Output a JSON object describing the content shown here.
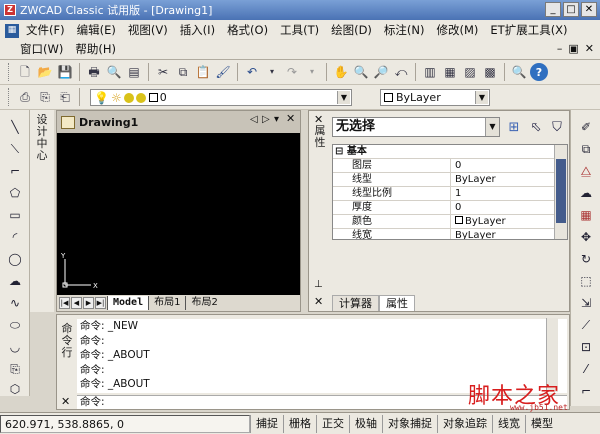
{
  "window": {
    "title": "ZWCAD Classic 试用版 - [Drawing1]",
    "logo": "Z"
  },
  "menu": {
    "row1": [
      "文件(F)",
      "编辑(E)",
      "视图(V)",
      "插入(I)",
      "格式(O)",
      "工具(T)",
      "绘图(D)",
      "标注(N)",
      "修改(M)",
      "ET扩展工具(X)"
    ],
    "row2": [
      "窗口(W)",
      "帮助(H)"
    ]
  },
  "layer_toolbar": {
    "layer_value": "0",
    "color_value": "ByLayer"
  },
  "drawing": {
    "tab_title": "Drawing1",
    "layout_tabs": [
      "Model",
      "布局1",
      "布局2"
    ],
    "axis_x": "X",
    "axis_y": "Y"
  },
  "properties": {
    "selection": "无选择",
    "category": "基本",
    "rows": [
      {
        "key": "图层",
        "value": "0"
      },
      {
        "key": "线型",
        "value": "ByLayer"
      },
      {
        "key": "线型比例",
        "value": "1"
      },
      {
        "key": "厚度",
        "value": "0"
      },
      {
        "key": "颜色",
        "value": "ByLayer"
      },
      {
        "key": "线宽",
        "value": "ByLayer"
      }
    ],
    "tabs": [
      "计算器",
      "属性"
    ],
    "side_caption": "属性"
  },
  "left_caption": "设计中心",
  "command": {
    "side_caption": "命令行",
    "history": [
      "命令: _NEW",
      "命令:",
      "命令: _ABOUT",
      "命令:",
      "命令: _ABOUT"
    ],
    "prompt": "命令:"
  },
  "status": {
    "coords": "620.971, 538.8865, 0",
    "buttons": [
      "捕捉",
      "栅格",
      "正交",
      "极轴",
      "对象捕捉",
      "对象追踪",
      "线宽",
      "模型"
    ]
  },
  "watermark": {
    "text": "脚本之家",
    "site": "www.jb51.net"
  },
  "colors": {
    "canvas": "#000000",
    "title_bar": "#4a72b4",
    "watermark": "#d81e1e"
  }
}
